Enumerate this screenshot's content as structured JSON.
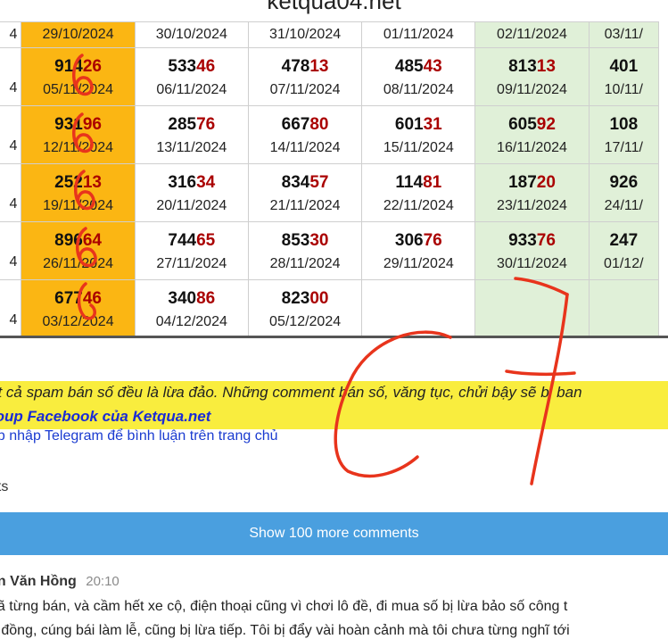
{
  "site_title": "ketqua04.net",
  "table": {
    "header_row": {
      "first": "4",
      "dates": [
        "29/10/2024",
        "30/10/2024",
        "31/10/2024",
        "01/11/2024",
        "02/11/2024",
        "03/11/"
      ]
    },
    "rows": [
      {
        "first": "4",
        "cells": [
          {
            "num_a": "914",
            "num_b": "26",
            "date": "05/11/2024"
          },
          {
            "num_a": "533",
            "num_b": "46",
            "date": "06/11/2024"
          },
          {
            "num_a": "478",
            "num_b": "13",
            "date": "07/11/2024"
          },
          {
            "num_a": "485",
            "num_b": "43",
            "date": "08/11/2024"
          },
          {
            "num_a": "813",
            "num_b": "13",
            "date": "09/11/2024"
          },
          {
            "num_a": "401",
            "num_b": "",
            "date": "10/11/"
          }
        ]
      },
      {
        "first": "4",
        "cells": [
          {
            "num_a": "931",
            "num_b": "96",
            "date": "12/11/2024"
          },
          {
            "num_a": "285",
            "num_b": "76",
            "date": "13/11/2024"
          },
          {
            "num_a": "667",
            "num_b": "80",
            "date": "14/11/2024"
          },
          {
            "num_a": "601",
            "num_b": "31",
            "date": "15/11/2024"
          },
          {
            "num_a": "605",
            "num_b": "92",
            "date": "16/11/2024"
          },
          {
            "num_a": "108",
            "num_b": "",
            "date": "17/11/"
          }
        ]
      },
      {
        "first": "4",
        "cells": [
          {
            "num_a": "252",
            "num_b": "13",
            "date": "19/11/2024"
          },
          {
            "num_a": "316",
            "num_b": "34",
            "date": "20/11/2024"
          },
          {
            "num_a": "834",
            "num_b": "57",
            "date": "21/11/2024"
          },
          {
            "num_a": "114",
            "num_b": "81",
            "date": "22/11/2024"
          },
          {
            "num_a": "187",
            "num_b": "20",
            "date": "23/11/2024"
          },
          {
            "num_a": "926",
            "num_b": "",
            "date": "24/11/"
          }
        ]
      },
      {
        "first": "4",
        "cells": [
          {
            "num_a": "896",
            "num_b": "64",
            "date": "26/11/2024"
          },
          {
            "num_a": "744",
            "num_b": "65",
            "date": "27/11/2024"
          },
          {
            "num_a": "853",
            "num_b": "30",
            "date": "28/11/2024"
          },
          {
            "num_a": "306",
            "num_b": "76",
            "date": "29/11/2024"
          },
          {
            "num_a": "933",
            "num_b": "76",
            "date": "30/11/2024"
          },
          {
            "num_a": "247",
            "num_b": "",
            "date": "01/12/"
          }
        ]
      },
      {
        "first": "4",
        "cells": [
          {
            "num_a": "677",
            "num_b": "46",
            "date": "03/12/2024"
          },
          {
            "num_a": "340",
            "num_b": "86",
            "date": "04/12/2024"
          },
          {
            "num_a": "823",
            "num_b": "00",
            "date": "05/12/2024"
          },
          {
            "num_a": "",
            "num_b": "",
            "date": ""
          },
          {
            "num_a": "",
            "num_b": "",
            "date": ""
          },
          {
            "num_a": "",
            "num_b": "",
            "date": ""
          }
        ]
      }
    ]
  },
  "notice": {
    "text": "ất cả spam bán số đều là lừa đảo. Những comment bán số, văng tục, chửi bậy sẽ bị ban",
    "group_link": "roup Facebook của Ketqua.net"
  },
  "login_link": "ập nhập Telegram để bình luận trên trang chủ",
  "comments_label": "nts",
  "show_more_label": "Show 100 more comments",
  "comment": {
    "author": "ễn Văn Hồng",
    "time": "20:10",
    "line1": "đã từng bán, và cầm hết xe cộ, điện thoại cũng vì chơi lô đề, đi mua số bị lừa bảo số công t",
    "line2": "ô đồng, cúng bái làm lễ, cũng bị lừa tiếp. Tôi bị đẩy vài hoàn cảnh mà tôi chưa từng nghĩ tới"
  },
  "annotation": {
    "handwritten_digits": [
      "6",
      "6",
      "6",
      "6"
    ],
    "handwritten_text": "C7",
    "color": "#e8341c"
  },
  "colors": {
    "orange_column": "#fbb613",
    "green_column": "#e0f0d8",
    "number_suffix": "#a00000",
    "notice_bg": "#f9ed3e",
    "button_bg": "#4a9fdf",
    "link": "#1a2bd6"
  }
}
